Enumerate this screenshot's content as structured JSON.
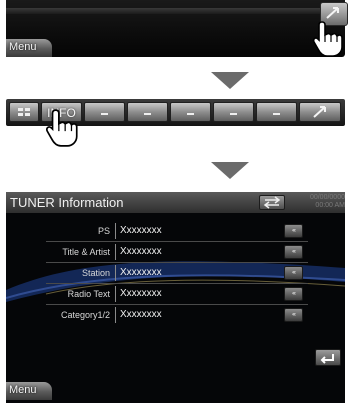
{
  "panel1": {
    "menu_label": "Menu",
    "button_icon": "shrink-arrow-icon"
  },
  "toolbar": {
    "left_icon": "menu-grid-icon",
    "info_label": "INFO",
    "blank_buttons": [
      "–",
      "–",
      "–",
      "–",
      "–"
    ],
    "right_icon": "shrink-arrow-icon"
  },
  "panel3": {
    "title": "TUNER Information",
    "clock_date": "00/00/0000",
    "clock_time": "00:00 AM",
    "rows": [
      {
        "label": "PS",
        "value": "Xxxxxxxx",
        "scroll": "‹‹‹"
      },
      {
        "label": "Title & Artist",
        "value": "Xxxxxxxx",
        "scroll": "‹‹‹"
      },
      {
        "label": "Station",
        "value": "Xxxxxxxx",
        "scroll": "‹‹‹"
      },
      {
        "label": "Radio Text",
        "value": "Xxxxxxxx",
        "scroll": "‹‹‹"
      },
      {
        "label": "Category1/2",
        "value": "Xxxxxxxx",
        "scroll": "‹‹‹"
      }
    ],
    "menu_label": "Menu",
    "return_icon": "return-arrow-icon"
  },
  "colors": {
    "panel_bg": "#050608",
    "accent_swirl": "#1f3a7a"
  }
}
